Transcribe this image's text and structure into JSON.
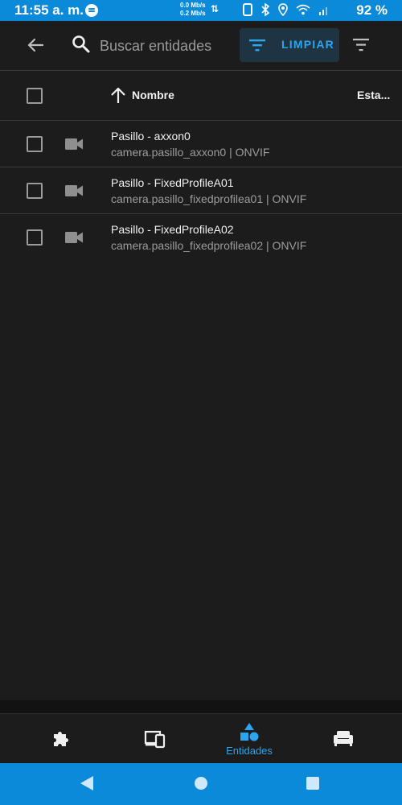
{
  "status_bar": {
    "time": "11:55 a. m.",
    "speed_down": "0.0 Mb/s",
    "speed_up": "0.2 Mb/s",
    "battery": "92 %"
  },
  "toolbar": {
    "search_placeholder": "Buscar entidades",
    "filter_chip_label": "LIMPIAR"
  },
  "table": {
    "headers": {
      "name": "Nombre",
      "state": "Esta..."
    },
    "rows": [
      {
        "name": "Pasillo - axxon0",
        "subtitle": "camera.pasillo_axxon0 | ONVIF",
        "icon": "camera-icon"
      },
      {
        "name": "Pasillo - FixedProfileA01",
        "subtitle": "camera.pasillo_fixedprofilea01 | ONVIF",
        "icon": "camera-icon"
      },
      {
        "name": "Pasillo - FixedProfileA02",
        "subtitle": "camera.pasillo_fixedprofilea02 | ONVIF",
        "icon": "camera-icon"
      }
    ]
  },
  "bottom_nav": {
    "items": [
      {
        "icon": "puzzle-icon",
        "label": ""
      },
      {
        "icon": "devices-icon",
        "label": ""
      },
      {
        "icon": "shapes-icon",
        "label": "Entidades",
        "active": true
      },
      {
        "icon": "sofa-icon",
        "label": ""
      }
    ]
  },
  "colors": {
    "accent": "#2aa6ef",
    "status_bar": "#0b8ad9",
    "background": "#1c1c1c"
  }
}
